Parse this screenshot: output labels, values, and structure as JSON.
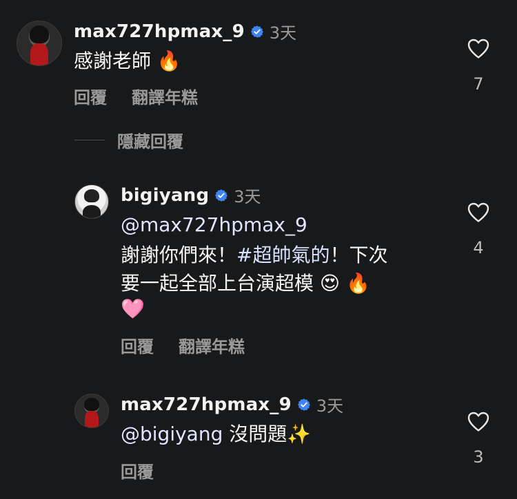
{
  "colors": {
    "background": "#18191b",
    "verified_blue": "#3f84f4",
    "muted": "#9a9a9a"
  },
  "comments": [
    {
      "username": "max727hpmax_9",
      "time": "3天",
      "text": "感謝老師",
      "emoji": "🔥",
      "actions": [
        "回覆",
        "翻譯年糕"
      ],
      "likes": "7"
    },
    {
      "username": "bigiyang",
      "time": "3天",
      "mention": "@max727hpmax_9",
      "line1_pre": "謝謝你們來！",
      "hashtag": "#超帥氣的",
      "line1_post": "！下次",
      "line2": "要一起全部上台演超模",
      "line2_emoji": "😍 🔥",
      "line3_emoji": "🩷",
      "actions": [
        "回覆",
        "翻譯年糕"
      ],
      "likes": "4"
    },
    {
      "username": "max727hpmax_9",
      "time": "3天",
      "mention": "@bigiyang",
      "text": "沒問題",
      "emoji": "✨",
      "actions": [
        "回覆"
      ],
      "likes": "3"
    }
  ],
  "hide_replies_label": "隱藏回覆",
  "icons": {
    "like": "heart-icon",
    "verified": "verified-badge-icon"
  }
}
